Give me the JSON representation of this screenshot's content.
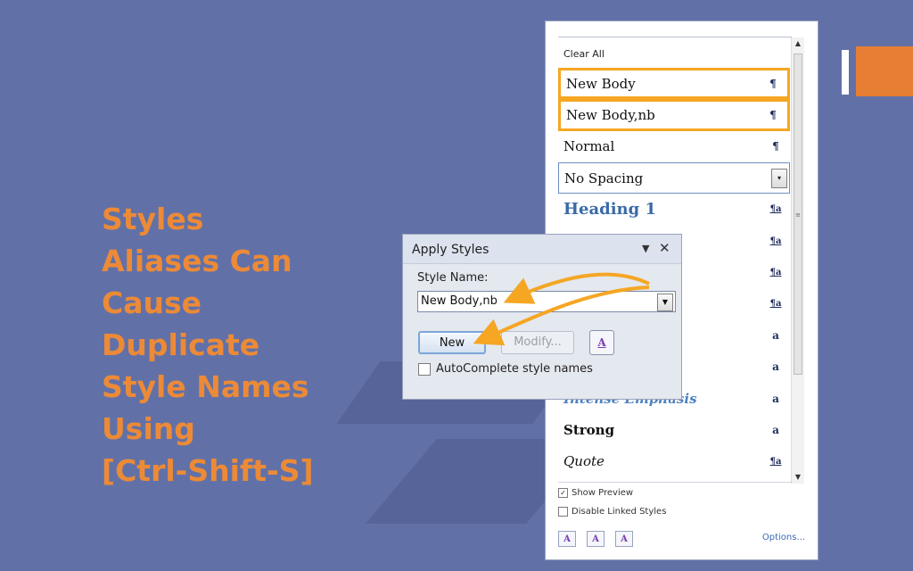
{
  "slide": {
    "title_lines": [
      "Styles",
      "Aliases Can",
      "Cause",
      "Duplicate",
      "Style Names",
      "Using",
      "[Ctrl-Shift-S]"
    ]
  },
  "styles_pane": {
    "clear_all": "Clear All",
    "items": [
      {
        "name": "New Body",
        "glyph": "¶"
      },
      {
        "name": "New Body,nb",
        "glyph": "¶"
      },
      {
        "name": "Normal",
        "glyph": "¶"
      },
      {
        "name": "No Spacing",
        "glyph": "▾"
      },
      {
        "name": "Heading 1",
        "glyph": "¶a"
      },
      {
        "name": "",
        "glyph": "¶a"
      },
      {
        "name": "",
        "glyph": "¶a"
      },
      {
        "name": "",
        "glyph": "¶a"
      },
      {
        "name": "",
        "glyph": "a"
      },
      {
        "name": "",
        "glyph": "a"
      },
      {
        "name": "Intense Emphasis",
        "glyph": "a"
      },
      {
        "name": "Strong",
        "glyph": "a"
      },
      {
        "name": "Quote",
        "glyph": "¶a"
      }
    ],
    "show_preview": "Show Preview",
    "show_preview_checked": true,
    "disable_linked": "Disable Linked Styles",
    "disable_linked_checked": false,
    "options_link": "Options...",
    "icon_new_style": "A",
    "icon_inspect": "A",
    "icon_manage": "A"
  },
  "apply_styles": {
    "title": "Apply Styles",
    "style_name_label": "Style Name:",
    "style_name_value": "New Body,nb",
    "new_button": "New",
    "modify_button": "Modify...",
    "styles_icon": "A",
    "autocomplete_label": "AutoComplete style names",
    "autocomplete_checked": false
  },
  "colors": {
    "background": "#6171a8",
    "title": "#ec8a37",
    "highlight": "#f5a623",
    "accent": "#e67e33"
  }
}
